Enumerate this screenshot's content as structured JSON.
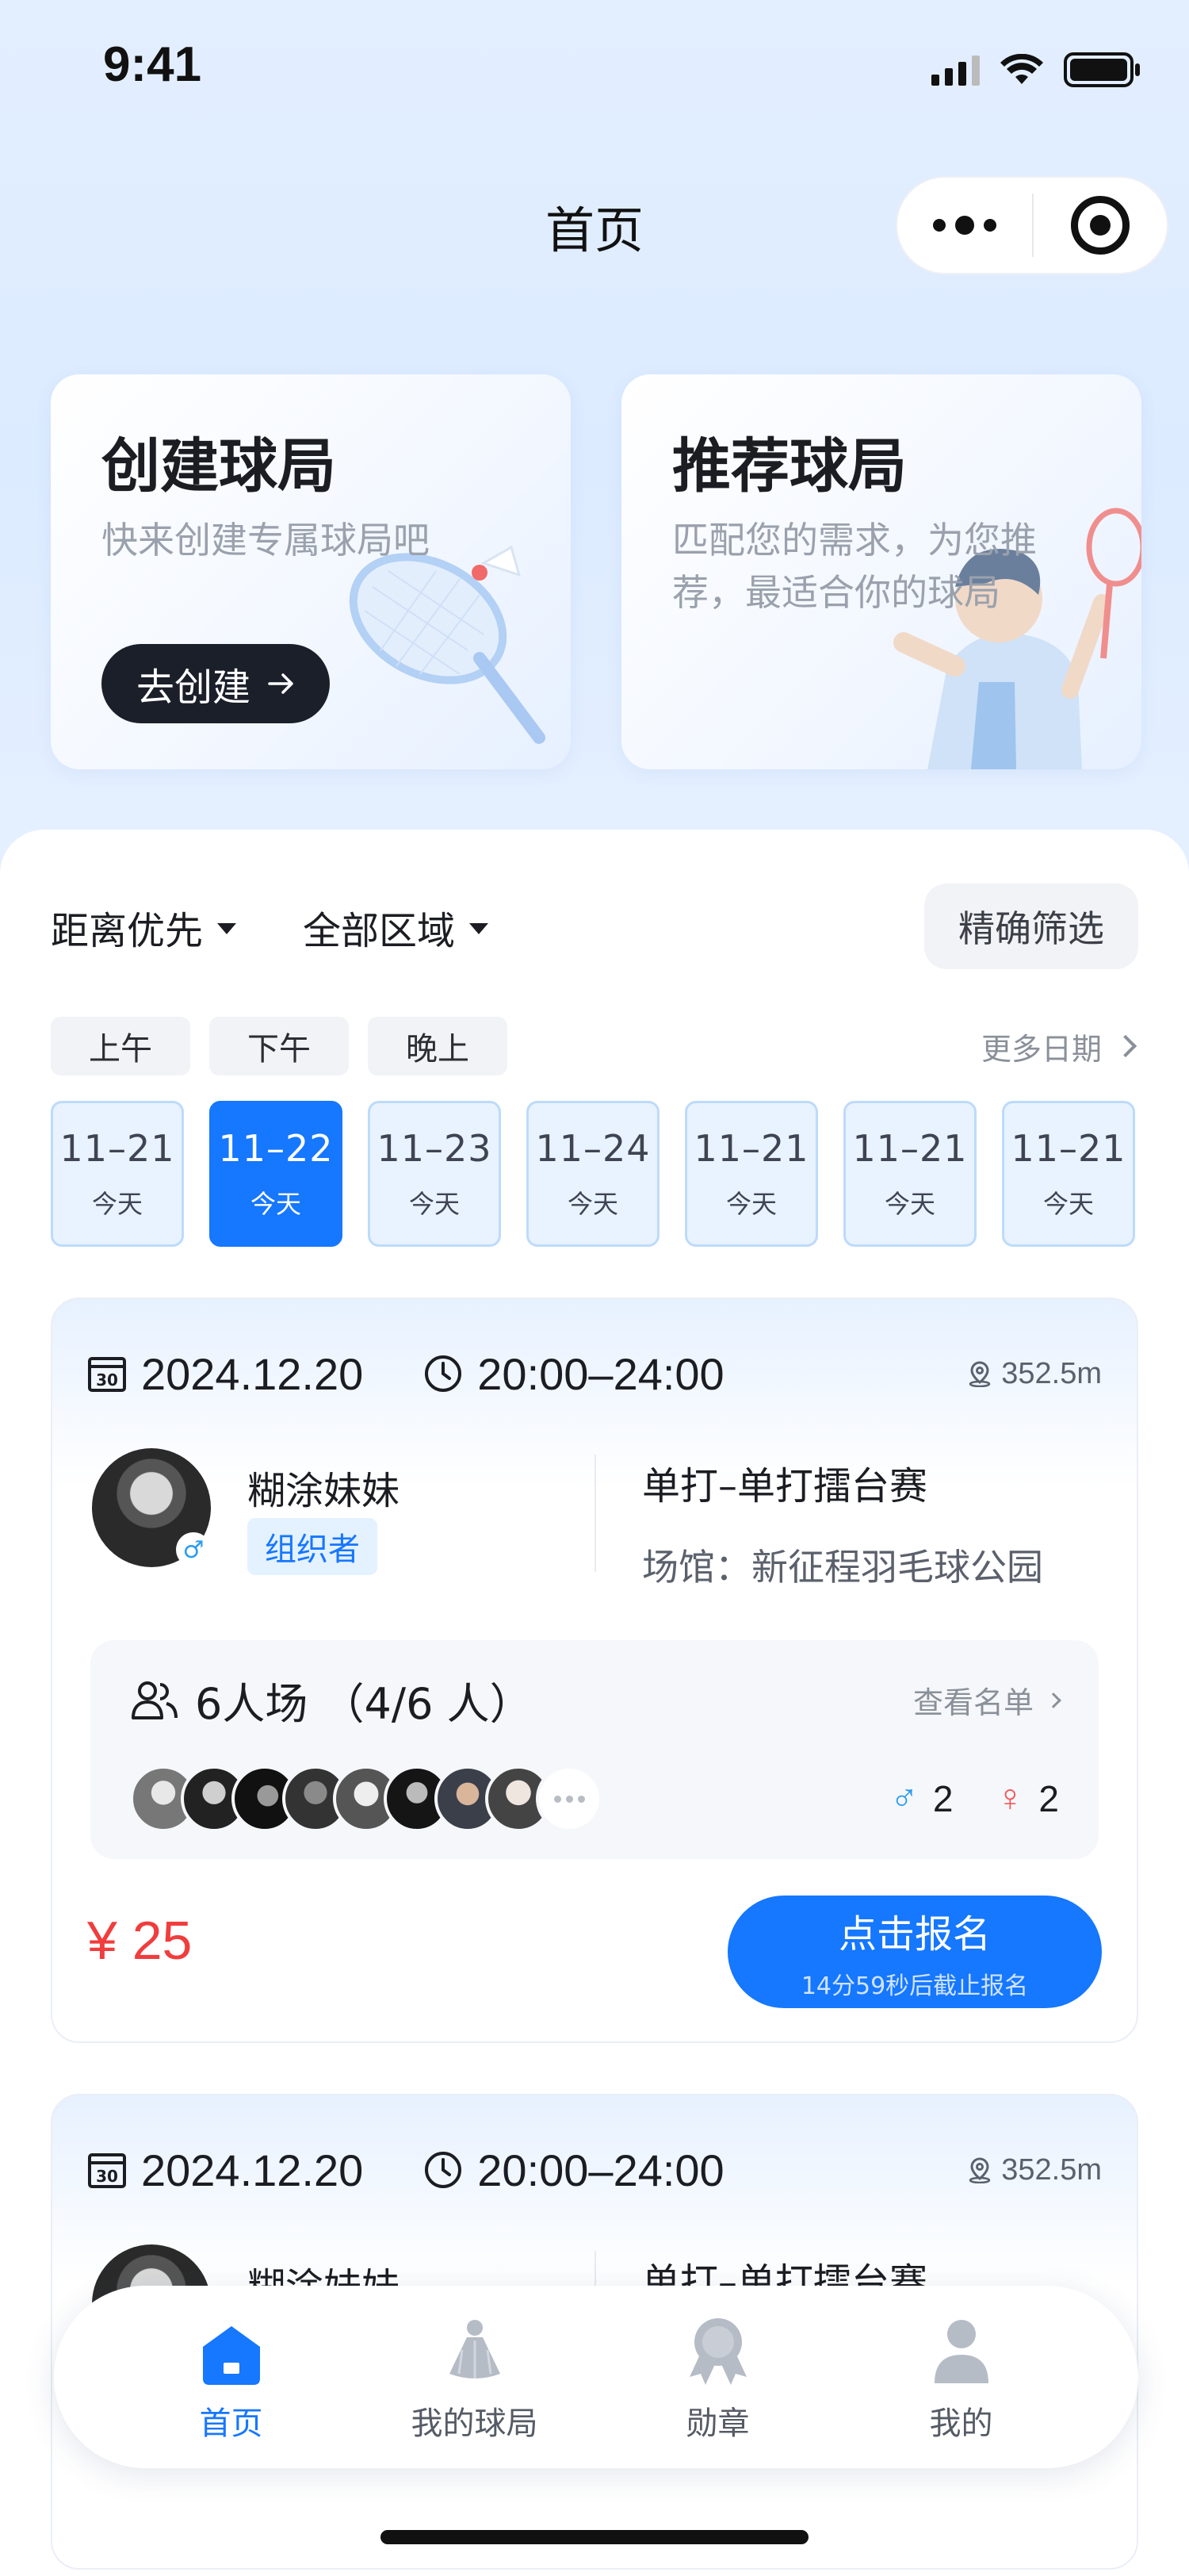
{
  "status_bar": {
    "time": "9:41"
  },
  "nav": {
    "title": "首页"
  },
  "hero": {
    "create": {
      "title": "创建球局",
      "subtitle": "快来创建专属球局吧",
      "button": "去创建"
    },
    "recommend": {
      "title": "推荐球局",
      "subtitle": "匹配您的需求，为您推荐，最适合你的球局"
    }
  },
  "filters": {
    "sort": "距离优先",
    "region": "全部区域",
    "precise": "精确筛选"
  },
  "periods": {
    "items": [
      "上午",
      "下午",
      "晚上"
    ],
    "more_dates": "更多日期"
  },
  "dates": [
    {
      "date": "11–21",
      "label": "今天",
      "active": false
    },
    {
      "date": "11–22",
      "label": "今天",
      "active": true
    },
    {
      "date": "11–23",
      "label": "今天",
      "active": false
    },
    {
      "date": "11–24",
      "label": "今天",
      "active": false
    },
    {
      "date": "11–21",
      "label": "今天",
      "active": false
    },
    {
      "date": "11–21",
      "label": "今天",
      "active": false
    },
    {
      "date": "11–21",
      "label": "今天",
      "active": false
    }
  ],
  "games": [
    {
      "date": "2024.12.20",
      "time": "20:00–24:00",
      "distance": "352.5m",
      "organizer_name": "糊涂妹妹",
      "organizer_badge": "组织者",
      "game_type": "单打–单打擂台赛",
      "venue": "场馆：新征程羽毛球公园",
      "roster_title": "6人场 （4/6 人）",
      "roster_link": "查看名单",
      "male_count": "2",
      "female_count": "2",
      "price": "¥ 25",
      "signup_label": "点击报名",
      "signup_deadline": "14分59秒后截止报名"
    },
    {
      "date": "2024.12.20",
      "time": "20:00–24:00",
      "distance": "352.5m",
      "organizer_name": "糊涂妹妹",
      "game_type": "单打–单打擂台赛"
    }
  ],
  "tabbar": {
    "home": "首页",
    "my_games": "我的球局",
    "badges": "勋章",
    "mine": "我的"
  },
  "colors": {
    "accent": "#1677ff",
    "price": "#f03d3d",
    "male": "#2a9cf2",
    "female": "#f05a5a"
  }
}
